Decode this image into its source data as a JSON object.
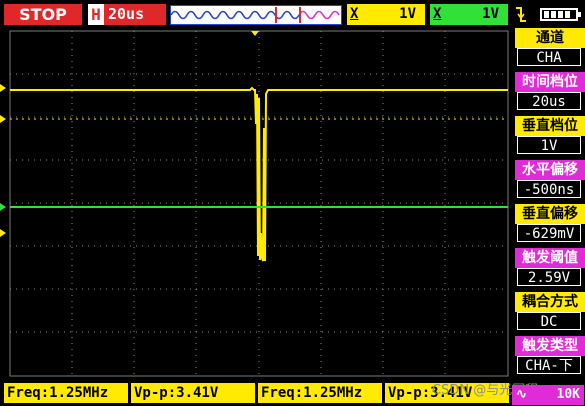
{
  "topbar": {
    "run_state": "STOP",
    "timebase_mode": "H",
    "timebase_value": "20us",
    "ch1": {
      "coupling_icon": "X",
      "scale": "1V"
    },
    "ch2": {
      "coupling_icon": "X",
      "scale": "1V"
    },
    "trigger_edge_icon": "falling-edge-icon",
    "battery_icon": "battery-icon"
  },
  "menu": [
    {
      "label": "通道",
      "value": "CHA",
      "color": "yellow"
    },
    {
      "label": "时间档位",
      "value": "20us",
      "color": "magenta"
    },
    {
      "label": "垂直档位",
      "value": "1V",
      "color": "yellow"
    },
    {
      "label": "水平偏移",
      "value": "-500ns",
      "color": "magenta"
    },
    {
      "label": "垂直偏移",
      "value": "-629mV",
      "color": "yellow"
    },
    {
      "label": "触发阈值",
      "value": "2.59V",
      "color": "magenta"
    },
    {
      "label": "耦合方式",
      "value": "DC",
      "color": "yellow"
    },
    {
      "label": "触发类型",
      "value": "CHA-下",
      "color": "magenta"
    }
  ],
  "bottombar": {
    "meas": [
      "Freq:1.25MHz",
      "Vp-p:3.41V",
      "Freq:1.25MHz",
      "Vp-p:3.41V"
    ],
    "watermark": "CSDN @与光同程",
    "sample_icon": "wave-icon",
    "sample_value": "10K"
  },
  "colors": {
    "ch1": "#ffea00",
    "ch2": "#32e03a",
    "accent_red": "#e0282b",
    "accent_magenta": "#e02bd6"
  }
}
